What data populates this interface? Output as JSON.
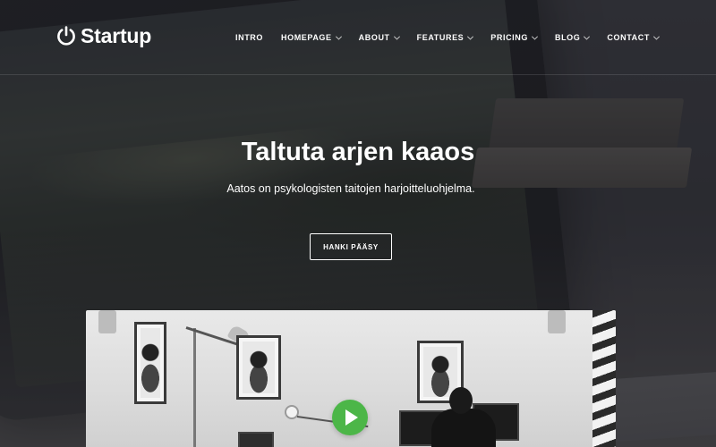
{
  "brand": {
    "name": "Startup",
    "icon": "power-icon"
  },
  "nav": {
    "items": [
      {
        "label": "INTRO",
        "has_dropdown": false
      },
      {
        "label": "HOMEPAGE",
        "has_dropdown": true
      },
      {
        "label": "ABOUT",
        "has_dropdown": true
      },
      {
        "label": "FEATURES",
        "has_dropdown": true
      },
      {
        "label": "PRICING",
        "has_dropdown": true
      },
      {
        "label": "BLOG",
        "has_dropdown": true
      },
      {
        "label": "CONTACT",
        "has_dropdown": true
      }
    ]
  },
  "hero": {
    "title": "Taltuta arjen kaaos",
    "subtitle": "Aatos on psykologisten taitojen harjoitteluohjelma.",
    "cta_label": "HANKI PÄÄSY"
  },
  "video": {
    "play_icon": "play-icon",
    "play_color": "#4cb648"
  },
  "colors": {
    "text": "#ffffff",
    "accent": "#4cb648"
  }
}
